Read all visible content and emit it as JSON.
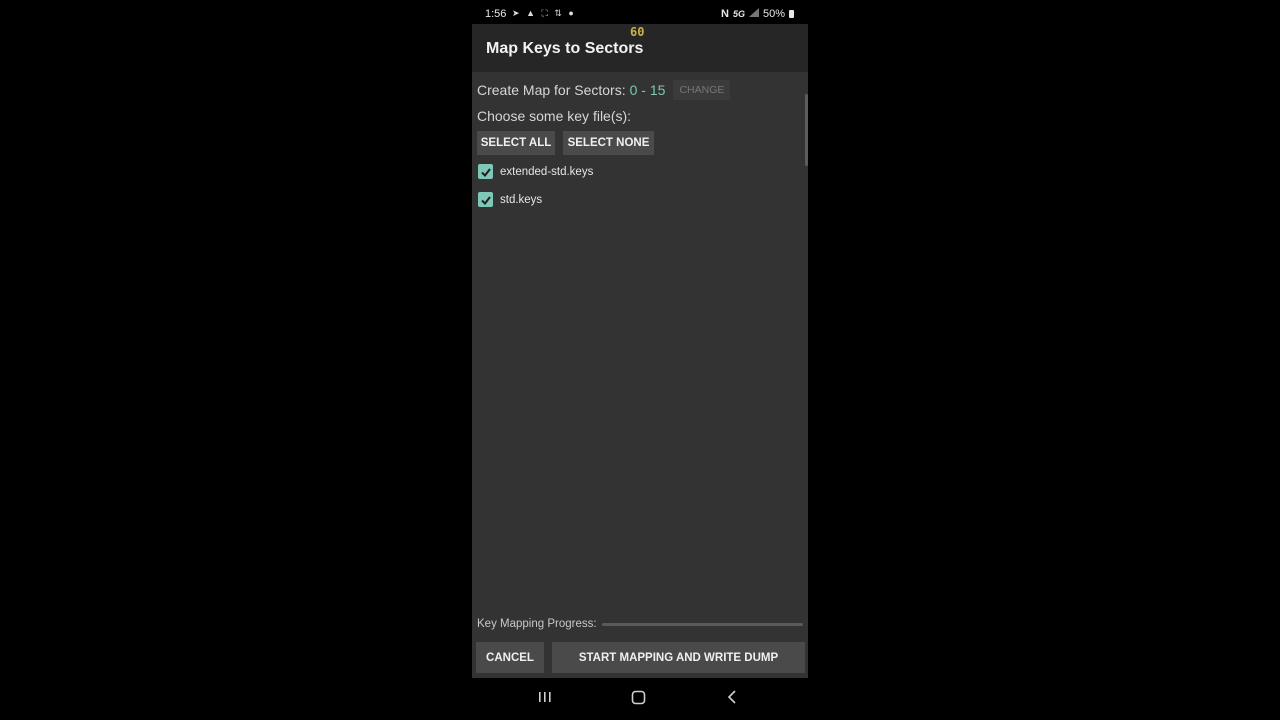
{
  "status_bar": {
    "time": "1:56",
    "left_icons": [
      "telegram-icon",
      "alert-icon",
      "screenshot-icon",
      "data-speed-icon",
      "notification-icon"
    ],
    "right_icons": [
      "nfc-icon",
      "5g-icon",
      "signal-icon"
    ],
    "battery": "50%",
    "fps": "60"
  },
  "app_bar": {
    "title": "Map Keys to Sectors"
  },
  "sectors": {
    "label": "Create Map for Sectors:",
    "range": "0 - 15",
    "change_label": "CHANGE"
  },
  "key_files": {
    "label": "Choose some key file(s):",
    "select_all_label": "SELECT ALL",
    "select_none_label": "SELECT NONE",
    "files": [
      {
        "name": "extended-std.keys",
        "checked": true
      },
      {
        "name": "std.keys",
        "checked": true
      }
    ]
  },
  "progress": {
    "label": "Key Mapping Progress:",
    "value": 0
  },
  "actions": {
    "cancel_label": "CANCEL",
    "start_label": "START MAPPING AND WRITE DUMP"
  },
  "colors": {
    "accent": "#7fc7b6",
    "background": "#333333",
    "app_bar": "#262626",
    "button": "#4a4a4a"
  },
  "nav_bar": {
    "icons": [
      "recents-icon",
      "home-icon",
      "back-icon"
    ]
  }
}
